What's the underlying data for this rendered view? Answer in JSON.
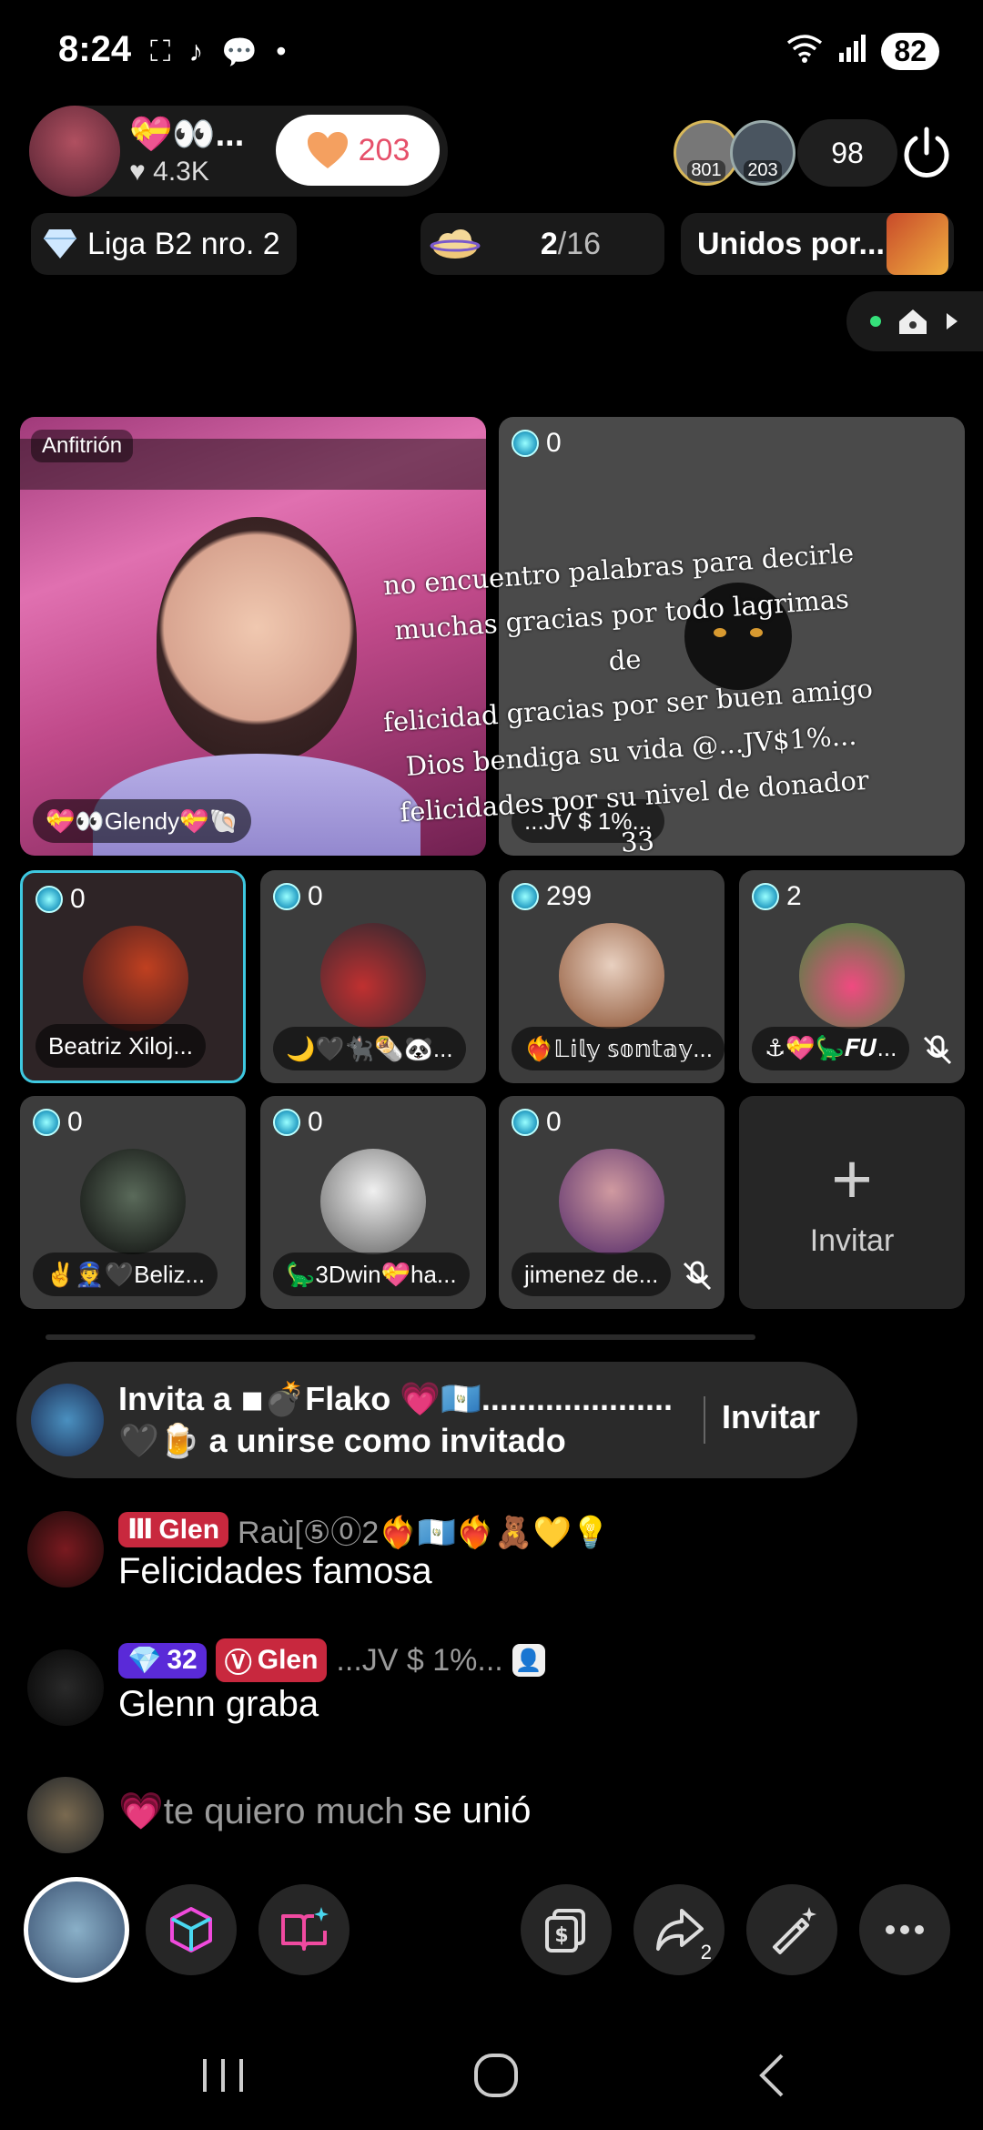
{
  "status_bar": {
    "time": "8:24",
    "battery": "82",
    "signal_label": "5"
  },
  "host": {
    "name": "💝👀...",
    "likes": "♥ 4.3K",
    "follow_count": "203"
  },
  "viewers": {
    "top1_score": "801",
    "top2_score": "203",
    "count": "98"
  },
  "chips": {
    "league": "Liga B2 nro. 2",
    "progress_current": "2",
    "progress_total": "/16",
    "united": "Unidos por..."
  },
  "grid": {
    "host_tag": "Anfitrión",
    "host_name": "💝👀Glendy💝🐚",
    "big_guest": {
      "count": "0",
      "name": "...JV  $  1%...",
      "overlay_lines": [
        "no encuentro palabras para decirle",
        "muchas gracias por todo lagrimas de",
        "felicidad gracias por ser buen amigo",
        "Dios bendiga su vida  @...JV$1%...",
        "felicidades por su nivel de donador 33"
      ]
    },
    "guests": [
      {
        "count": "0",
        "name": "Beatriz Xiloj..."
      },
      {
        "count": "0",
        "name": "🌙🖤🐈‍⬛🌯🐼..."
      },
      {
        "count": "299",
        "name": "❤️‍🔥𝕃𝕚𝕝𝕪 𝕤𝕠𝕟𝕥𝕒𝕪..."
      },
      {
        "count": "2",
        "name": "⚓💝🦕𝑭𝑼..."
      },
      {
        "count": "0",
        "name": "✌️👮🖤Beliz..."
      },
      {
        "count": "0",
        "name": "🦕3Dwin💝ha..."
      },
      {
        "count": "0",
        "name": "jimenez de..."
      }
    ],
    "invite_label": "Invitar"
  },
  "invite_banner": {
    "line1": "Invita a ◾💣Flako 💗🇬🇹.....................",
    "line2": "🖤🍺 a unirse como invitado",
    "button": "Invitar"
  },
  "chat": [
    {
      "badge": "Glen",
      "user": "Raù[⑤⓪2❤️‍🔥🇬🇹❤️‍🔥🧸💛💡",
      "text": "Felicidades famosa"
    },
    {
      "level": "32",
      "badge": "Glen",
      "user": "...JV  $  1%...",
      "text": "Glenn graba"
    },
    {
      "user": "💗te quiero much",
      "text": "se unió"
    }
  ],
  "actions": {
    "share_count": "2"
  },
  "colors": {
    "accent_pink": "#e6506a",
    "badge_red": "#c8283e",
    "badge_purple": "#5a2ad8",
    "selected_border": "#3ec8e0"
  }
}
